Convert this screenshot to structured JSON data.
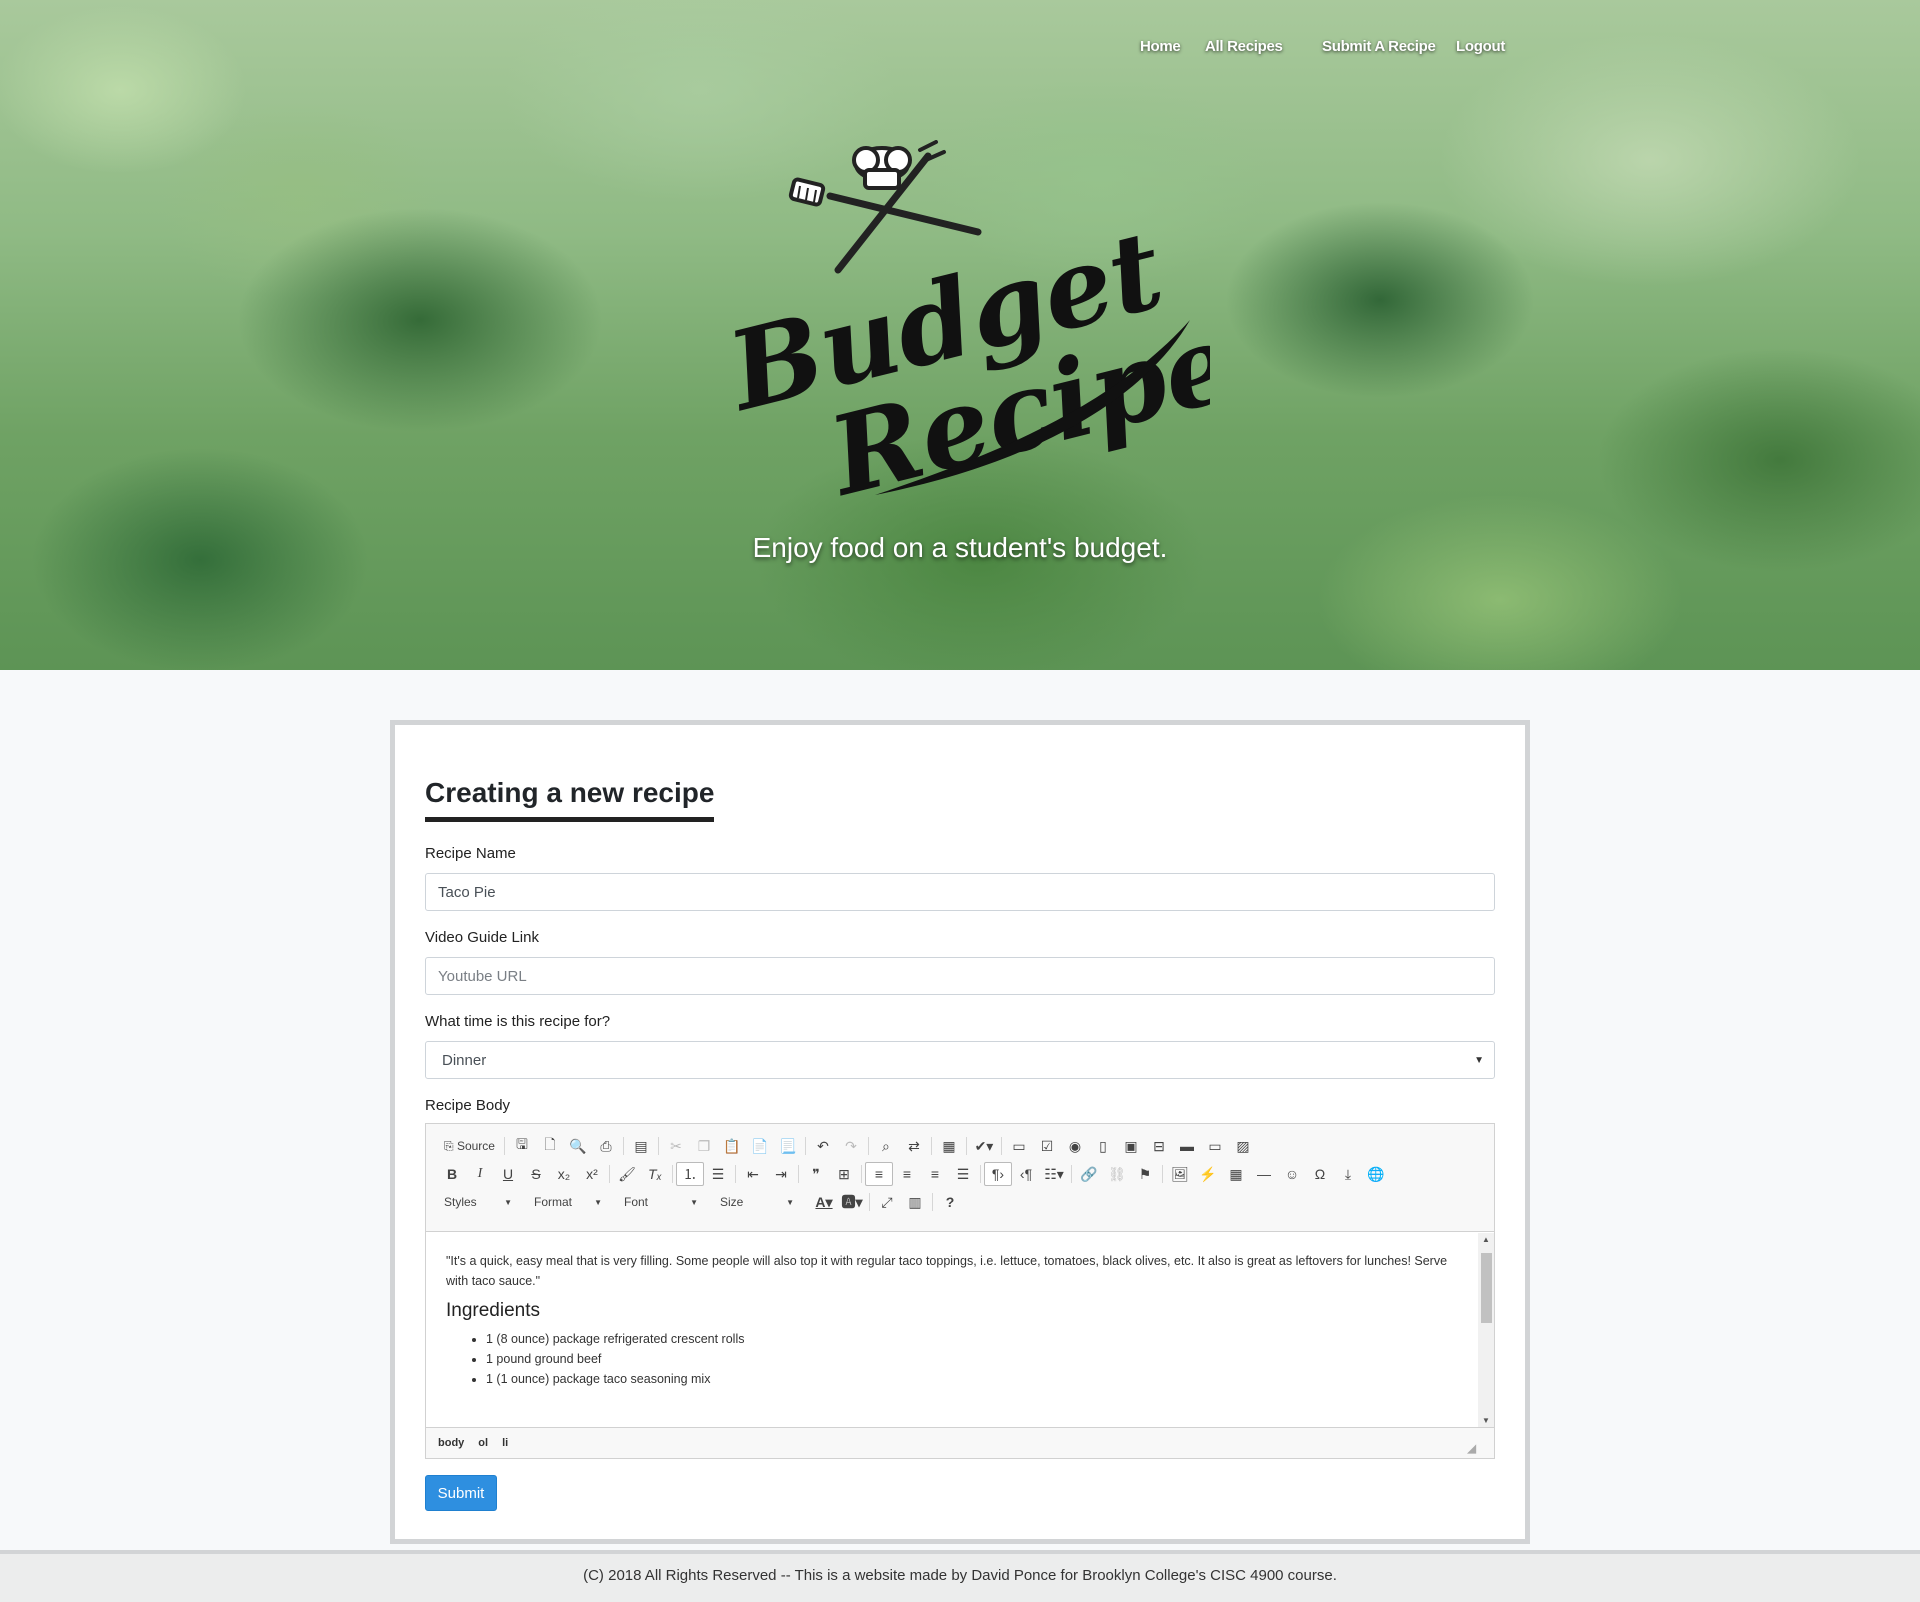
{
  "nav": {
    "home": "Home",
    "all_recipes": "All Recipes",
    "submit_recipe": "Submit A Recipe",
    "logout": "Logout"
  },
  "logo": {
    "line1": "Budget",
    "line2": "Recipes"
  },
  "hero": {
    "tagline": "Enjoy food on a student's budget."
  },
  "form": {
    "title": "Creating a new recipe",
    "recipe_name_label": "Recipe Name",
    "recipe_name_value": "Taco Pie",
    "video_label": "Video Guide Link",
    "video_placeholder": "Youtube URL",
    "time_label": "What time is this recipe for?",
    "time_value": "Dinner",
    "body_label": "Recipe Body",
    "submit_label": "Submit"
  },
  "editor": {
    "source_label": "Source",
    "styles_label": "Styles",
    "format_label": "Format",
    "font_label": "Font",
    "size_label": "Size",
    "intro": "\"It's a quick, easy meal that is very filling. Some people will also top it with regular taco toppings, i.e. lettuce, tomatoes, black olives, etc. It also is great as leftovers for lunches! Serve with taco sauce.\"",
    "heading": "Ingredients",
    "ingredients": [
      "1 (8 ounce) package refrigerated crescent rolls",
      "1 pound ground beef",
      "1 (1 ounce) package taco seasoning mix"
    ],
    "path": [
      "body",
      "ol",
      "li"
    ]
  },
  "footer": {
    "text": "(C) 2018 All Rights Reserved -- This is a website made by David Ponce for Brooklyn College's CISC 4900 course."
  },
  "colors": {
    "accent": "#2e8fe0",
    "card_border": "#d2d4d6"
  }
}
